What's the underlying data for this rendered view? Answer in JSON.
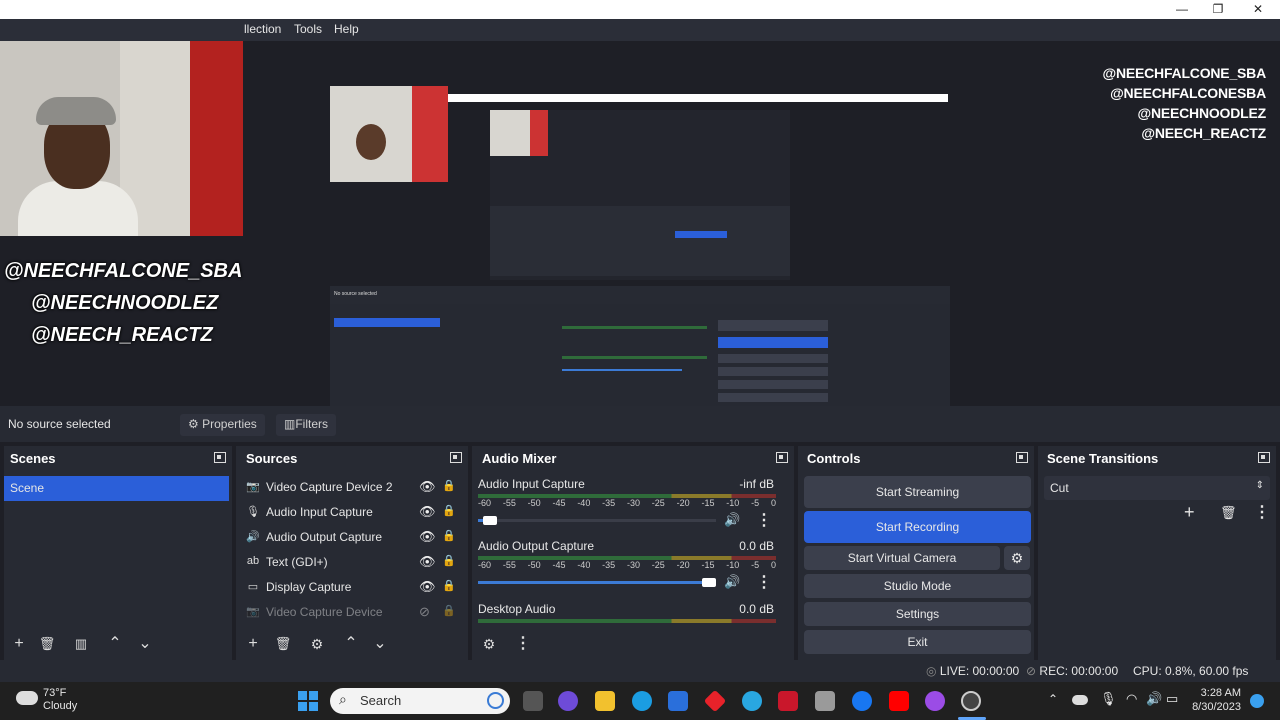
{
  "window": {
    "controls": [
      "—",
      "❐",
      "✕"
    ]
  },
  "menu": {
    "items": [
      "llection",
      "Tools",
      "Help"
    ]
  },
  "overlay": {
    "handles_right": [
      "@NEECHFALCONE_SBA",
      "@NEECHFALCONESBA",
      "@NEECHNOODLEZ",
      "@NEECH_REACTZ"
    ],
    "handles_left": [
      "@NEECHFALCONE_SBA",
      "@NEECHNOODLEZ",
      "@NEECH_REACTZ"
    ]
  },
  "source_bar": {
    "status": "No source selected",
    "properties": "Properties",
    "filters": "Filters"
  },
  "scenes": {
    "title": "Scenes",
    "items": [
      "Scene"
    ]
  },
  "sources": {
    "title": "Sources",
    "items": [
      {
        "label": "Video Capture Device 2",
        "icon": "camera-icon"
      },
      {
        "label": "Audio Input Capture",
        "icon": "microphone-icon"
      },
      {
        "label": "Audio Output Capture",
        "icon": "speaker-icon"
      },
      {
        "label": "Text (GDI+)",
        "icon": "text-icon"
      },
      {
        "label": "Display Capture",
        "icon": "monitor-icon"
      },
      {
        "label": "Video Capture Device",
        "icon": "camera-icon"
      }
    ]
  },
  "audio_mixer": {
    "title": "Audio Mixer",
    "scale": [
      "-60",
      "-55",
      "-50",
      "-45",
      "-40",
      "-35",
      "-30",
      "-25",
      "-20",
      "-15",
      "-10",
      "-5",
      "0"
    ],
    "channels": [
      {
        "name": "Audio Input Capture",
        "level": "-inf dB",
        "volume": 0.05
      },
      {
        "name": "Audio Output Capture",
        "level": "0.0 dB",
        "volume": 1.0
      },
      {
        "name": "Desktop Audio",
        "level": "0.0 dB"
      }
    ]
  },
  "controls": {
    "title": "Controls",
    "start_streaming": "Start Streaming",
    "start_recording": "Start Recording",
    "start_virtual_camera": "Start Virtual Camera",
    "studio_mode": "Studio Mode",
    "settings": "Settings",
    "exit": "Exit"
  },
  "scene_transitions": {
    "title": "Scene Transitions",
    "selected": "Cut"
  },
  "status": {
    "live": "LIVE: 00:00:00",
    "rec": "REC: 00:00:00",
    "cpu": "CPU: 0.8%, 60.00 fps"
  },
  "taskbar": {
    "weather_temp": "73°F",
    "weather_desc": "Cloudy",
    "search": "Search",
    "time": "3:28 AM",
    "date": "8/30/2023"
  },
  "colors": {
    "accent": "#2b5fd9",
    "panel": "#272a33",
    "background": "#1e1f26"
  }
}
